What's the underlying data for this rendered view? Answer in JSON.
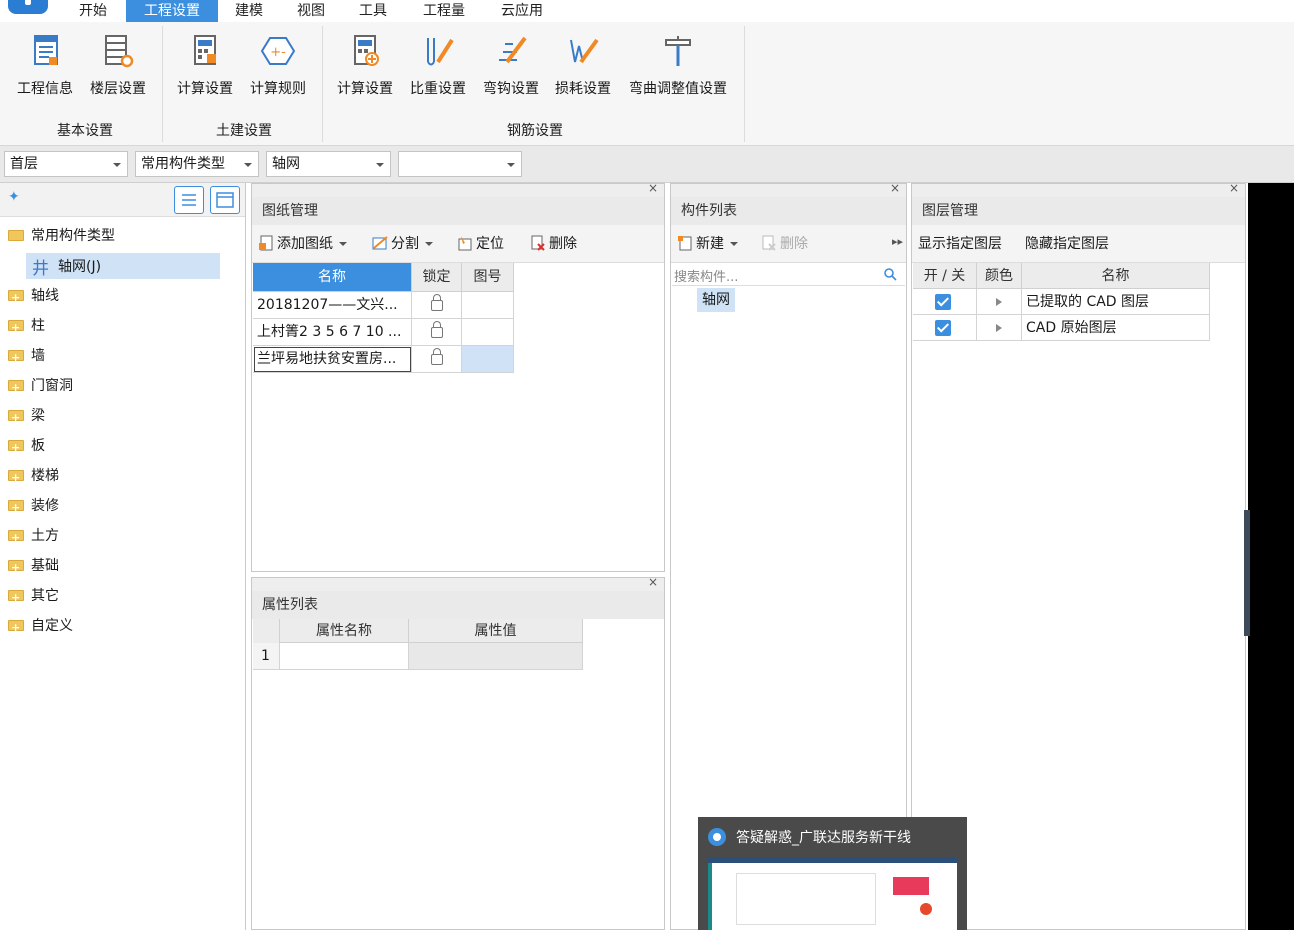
{
  "menu": {
    "items": [
      "开始",
      "工程设置",
      "建模",
      "视图",
      "工具",
      "工程量",
      "云应用"
    ],
    "active": "工程设置"
  },
  "ribbon": {
    "groups": [
      {
        "label": "基本设置",
        "buttons": [
          "工程信息",
          "楼层设置"
        ]
      },
      {
        "label": "土建设置",
        "buttons": [
          "计算设置",
          "计算规则"
        ]
      },
      {
        "label": "钢筋设置",
        "buttons": [
          "计算设置",
          "比重设置",
          "弯钩设置",
          "损耗设置",
          "弯曲调整值设置"
        ]
      }
    ]
  },
  "toolbar": {
    "floor": "首层",
    "type": "常用构件类型",
    "component": "轴网",
    "extra": ""
  },
  "tree": {
    "root": "常用构件类型",
    "selected": "轴网(J)",
    "items": [
      "轴线",
      "柱",
      "墙",
      "门窗洞",
      "梁",
      "板",
      "楼梯",
      "装修",
      "土方",
      "基础",
      "其它",
      "自定义"
    ]
  },
  "drawing_panel": {
    "title": "图纸管理",
    "close": "×",
    "tools": {
      "add": "添加图纸",
      "split": "分割",
      "locate": "定位",
      "delete": "删除"
    },
    "columns": [
      "名称",
      "锁定",
      "图号"
    ],
    "rows": [
      {
        "name": "20181207——文兴...",
        "number": ""
      },
      {
        "name": "上村箐2 3 5 6 7 10 ...",
        "number": ""
      },
      {
        "name": "兰坪易地扶贫安置房...",
        "number": ""
      }
    ]
  },
  "property_panel": {
    "title": "属性列表",
    "close": "×",
    "columns": [
      "属性名称",
      "属性值"
    ],
    "rows": [
      {
        "index": "1",
        "name": "",
        "value": ""
      }
    ]
  },
  "component_panel": {
    "title": "构件列表",
    "close": "×",
    "tools": {
      "new": "新建",
      "delete": "删除"
    },
    "search_placeholder": "搜索构件...",
    "items": [
      "轴网"
    ]
  },
  "layer_panel": {
    "title": "图层管理",
    "close": "×",
    "tools": {
      "show": "显示指定图层",
      "hide": "隐藏指定图层"
    },
    "columns": [
      "开 / 关",
      "颜色",
      "名称"
    ],
    "rows": [
      {
        "name": "已提取的 CAD 图层",
        "on": true
      },
      {
        "name": "CAD 原始图层",
        "on": true
      }
    ]
  },
  "popup": {
    "title": "答疑解惑_广联达服务新干线"
  },
  "colors": {
    "accent": "#3b8fde",
    "selected": "#cfe2f6"
  }
}
